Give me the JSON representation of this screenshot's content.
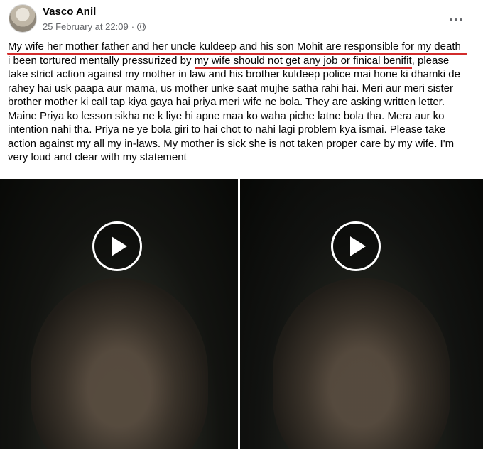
{
  "post": {
    "author": "Vasco Anil",
    "timestamp": "25 February at 22:09",
    "separator": "·",
    "lines": [
      "My wife her mother father and her uncle kuldeep and his son Mohit are responsible for my death",
      "i been tortured mentally pressurized by ",
      "my wife should not get any job or finical benifit",
      ", please",
      "take strict action against my mother in law and his brother kuldeep police mai hone ki dhamki de",
      "rahey hai usk paapa aur mama, us mother unke saat mujhe satha rahi hai. Meri aur meri sister",
      "brother mother ki call tap kiya gaya hai priya meri wife ne bola. They are asking written letter.",
      "Maine Priya ko lesson sikha ne k liye hi apne maa ko waha piche latne bola tha. Mera aur ko",
      "intention nahi tha. Priya ne ye bola giri to hai chot to nahi lagi problem kya ismai. Please take",
      "action against my all my in-laws. My mother is sick she is not taken proper care by my wife. I'm",
      "very loud and clear with my statement"
    ]
  },
  "icons": {
    "privacy": "globe-icon",
    "menu": "more-options-icon",
    "play": "play-icon"
  },
  "colors": {
    "underline": "#d22b2b",
    "meta_text": "#65676b"
  }
}
